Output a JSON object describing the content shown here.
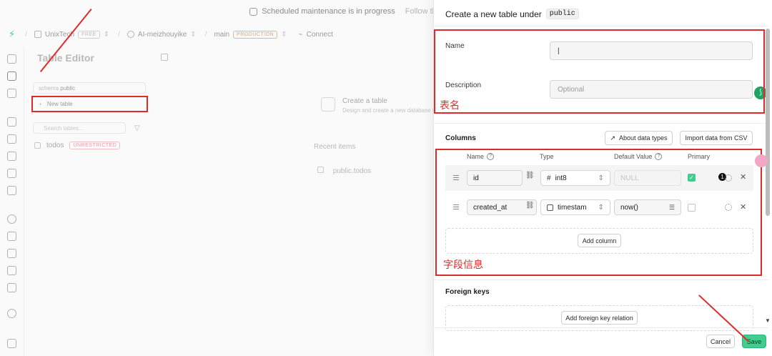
{
  "banner": {
    "text": "Scheduled maintenance is in progress",
    "follow": "Follow th"
  },
  "topbar": {
    "org": "UnixTech",
    "org_badge": "FREE",
    "project": "AI-meizhouyike",
    "branch": "main",
    "branch_badge": "PRODUCTION",
    "connect": "Connect"
  },
  "table_editor": {
    "title": "Table Editor",
    "schema_label": "schema",
    "schema_value": "public",
    "new_table": "New table",
    "search_placeholder": "Search tables...",
    "tables": [
      {
        "name": "todos",
        "badge": "UNRESTRICTED"
      }
    ],
    "create_title": "Create a table",
    "create_desc": "Design and create a new database table",
    "recent_title": "Recent items",
    "recent_item": "public.todos"
  },
  "panel": {
    "title": "Create a new table under",
    "schema": "public",
    "name_label": "Name",
    "name_value": "|",
    "description_label": "Description",
    "description_placeholder": "Optional",
    "annotation_name": "表名",
    "columns_label": "Columns",
    "about_types": "About data types",
    "import_csv": "Import data from CSV",
    "col_headers": {
      "name": "Name",
      "type": "Type",
      "default": "Default Value",
      "primary": "Primary"
    },
    "rows": [
      {
        "name": "id",
        "type_icon": "#",
        "type": "int8",
        "default": "NULL",
        "primary": true,
        "badge": "1"
      },
      {
        "name": "created_at",
        "type_icon": "calendar-icon",
        "type": "timestam",
        "default": "now()",
        "primary": false
      }
    ],
    "add_column": "Add column",
    "annotation_columns": "字段信息",
    "foreign_keys": "Foreign keys",
    "add_fk": "Add foreign key relation",
    "cancel": "Cancel",
    "save": "Save"
  },
  "colors": {
    "accent": "#3ecf8e",
    "annotation": "#e02b2b"
  }
}
